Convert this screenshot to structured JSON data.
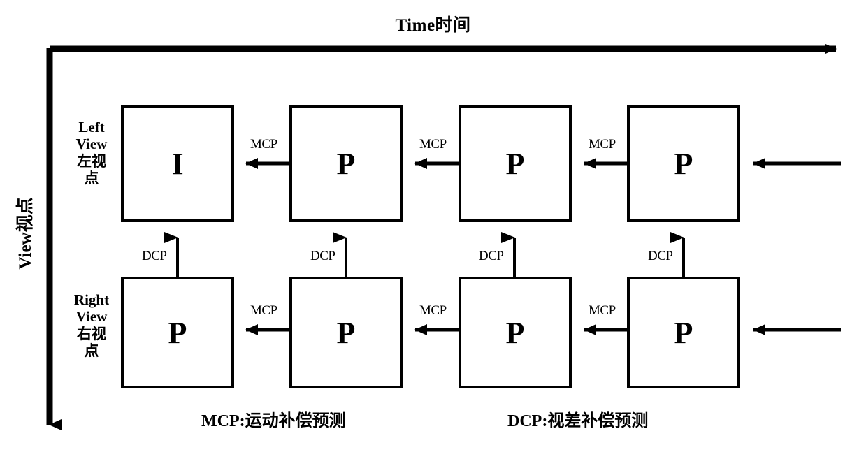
{
  "axes": {
    "time_label": "Time时间",
    "view_label": "View视点",
    "time_direction": "right",
    "view_direction": "down",
    "line_color": "#000000"
  },
  "rows": [
    {
      "id": "left-view",
      "en": "Left",
      "en2": "View",
      "zh": "左视",
      "zh2": "点"
    },
    {
      "id": "right-view",
      "en": "Right",
      "en2": "View",
      "zh": "右视",
      "zh2": "点"
    }
  ],
  "frames": {
    "top": [
      "I",
      "P",
      "P",
      "P"
    ],
    "bottom": [
      "P",
      "P",
      "P",
      "P"
    ]
  },
  "edges": {
    "mcp_label": "MCP",
    "dcp_label": "DCP",
    "top_mcp": [
      "MCP",
      "MCP",
      "MCP"
    ],
    "bottom_mcp": [
      "MCP",
      "MCP",
      "MCP"
    ],
    "dcp": [
      "DCP",
      "DCP",
      "DCP",
      "DCP"
    ]
  },
  "legend": {
    "mcp": "MCP:运动补偿预测",
    "dcp": "DCP:视差补偿预测"
  },
  "chart_data": {
    "type": "diagram",
    "title": "MVC prediction structure",
    "xlabel": "Time时间",
    "ylabel": "View视点",
    "columns": 4,
    "rows": 2,
    "nodes": [
      {
        "row": "left-view",
        "col": 0,
        "type": "I"
      },
      {
        "row": "left-view",
        "col": 1,
        "type": "P"
      },
      {
        "row": "left-view",
        "col": 2,
        "type": "P"
      },
      {
        "row": "left-view",
        "col": 3,
        "type": "P"
      },
      {
        "row": "right-view",
        "col": 0,
        "type": "P"
      },
      {
        "row": "right-view",
        "col": 1,
        "type": "P"
      },
      {
        "row": "right-view",
        "col": 2,
        "type": "P"
      },
      {
        "row": "right-view",
        "col": 3,
        "type": "P"
      }
    ],
    "links": [
      {
        "from": "left-view:1",
        "to": "left-view:0",
        "label": "MCP"
      },
      {
        "from": "left-view:2",
        "to": "left-view:1",
        "label": "MCP"
      },
      {
        "from": "left-view:3",
        "to": "left-view:2",
        "label": "MCP"
      },
      {
        "from": "right-view:1",
        "to": "right-view:0",
        "label": "MCP"
      },
      {
        "from": "right-view:2",
        "to": "right-view:1",
        "label": "MCP"
      },
      {
        "from": "right-view:3",
        "to": "right-view:2",
        "label": "MCP"
      },
      {
        "from": "right-view:0",
        "to": "left-view:0",
        "label": "DCP"
      },
      {
        "from": "right-view:1",
        "to": "left-view:1",
        "label": "DCP"
      },
      {
        "from": "right-view:2",
        "to": "left-view:2",
        "label": "DCP"
      },
      {
        "from": "right-view:3",
        "to": "left-view:3",
        "label": "DCP"
      }
    ]
  }
}
